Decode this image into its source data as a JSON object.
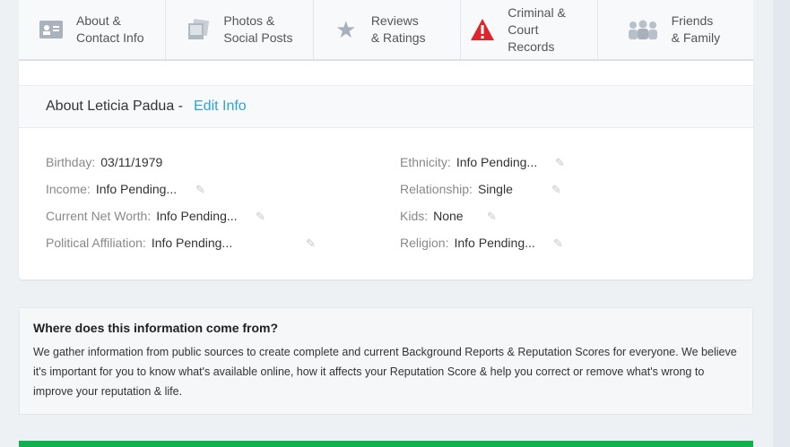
{
  "tabs": [
    {
      "line1": "About &",
      "line2": "Contact Info",
      "icon": "contact-card-icon"
    },
    {
      "line1": "Photos &",
      "line2": "Social Posts",
      "icon": "photos-icon"
    },
    {
      "line1": "Reviews",
      "line2": "& Ratings",
      "icon": "star-icon"
    },
    {
      "line1": "Criminal & Court",
      "line2": "Records",
      "icon": "warning-icon"
    },
    {
      "line1": "Friends",
      "line2": "& Family",
      "icon": "people-icon"
    }
  ],
  "about": {
    "title": "About Leticia Padua -",
    "edit": "Edit Info",
    "left": [
      {
        "k": "Birthday:",
        "v": "03/11/1979",
        "edit": false
      },
      {
        "k": "Income:",
        "v": "Info Pending...",
        "edit": true
      },
      {
        "k": "Current Net Worth:",
        "v": "Info Pending...",
        "edit": true
      },
      {
        "k": "Political Affiliation:",
        "v": "Info Pending...",
        "edit": true
      }
    ],
    "right": [
      {
        "k": "Ethnicity:",
        "v": "Info Pending...",
        "edit": true
      },
      {
        "k": "Relationship:",
        "v": "Single",
        "edit": true
      },
      {
        "k": "Kids:",
        "v": "None",
        "edit": true
      },
      {
        "k": "Religion:",
        "v": "Info Pending...",
        "edit": true
      }
    ]
  },
  "source": {
    "title": "Where does this information come from?",
    "body": "We gather information from public sources to create complete and current Background Reports & Reputation Scores for everyone. We believe it's important for you to know what's available online, how it affects your Reputation Score & help you correct or remove what's wrong to improve your reputation & life."
  },
  "colors": {
    "accent": "#2ea3d6",
    "alert": "#e0242b",
    "green": "#10b050"
  }
}
